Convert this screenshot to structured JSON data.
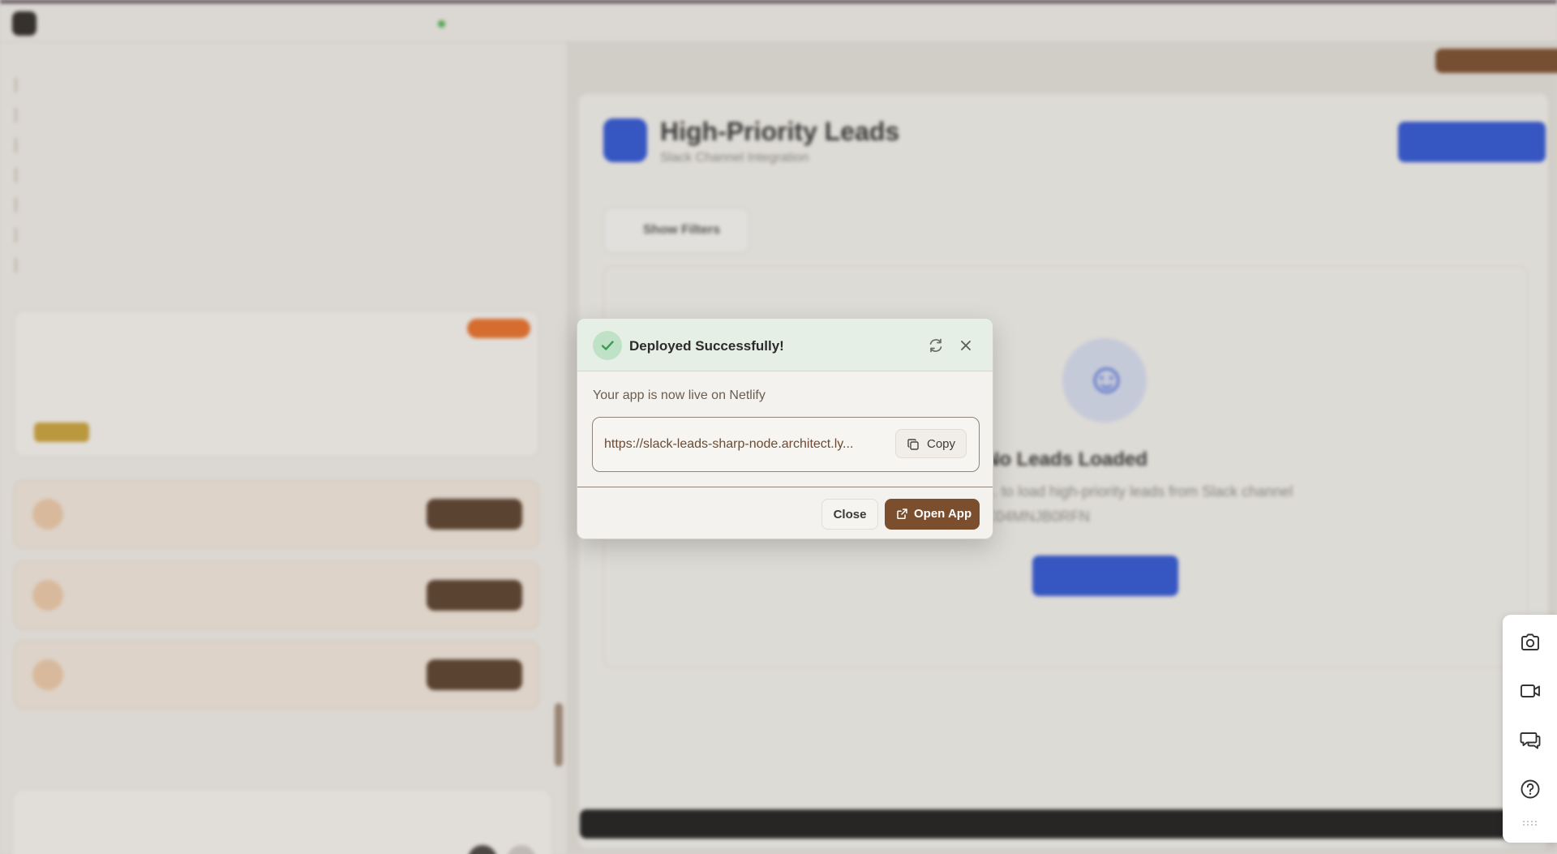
{
  "dialog": {
    "title": "Deployed Successfully!",
    "message": "Your app is now live on Netlify",
    "url": "https://slack-leads-sharp-node.architect.ly...",
    "copy_label": "Copy",
    "close_label": "Close",
    "open_label": "Open App"
  },
  "background": {
    "header_title": "High-Priority Leads",
    "header_subtitle": "Slack Channel Integration",
    "filters_label": "Show Filters",
    "empty_title": "No Leads Loaded",
    "empty_desc": "... to load high-priority leads from Slack channel C04MNJB0RFN"
  },
  "icons": {
    "success": "check-icon",
    "refresh": "refresh-icon",
    "close": "close-icon",
    "copy": "copy-icon",
    "open": "external-link-icon",
    "toolbar": [
      "camera-icon",
      "video-icon",
      "chat-icon",
      "help-icon"
    ]
  },
  "colors": {
    "accent": "#7b4e2d",
    "success_bg": "#e6efe6",
    "success_icon": "#4caf50",
    "primary_blue": "#2f55d4"
  }
}
